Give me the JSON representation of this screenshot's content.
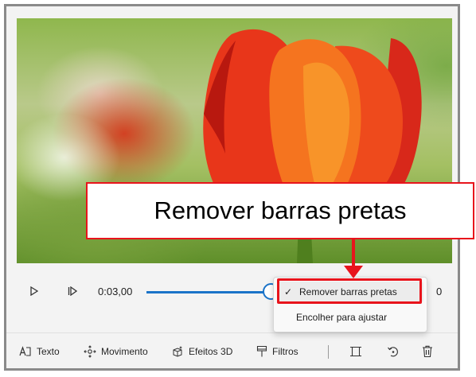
{
  "player": {
    "current_time": "0:03,00",
    "end_time_partial": "0",
    "progress_fraction": 0.46
  },
  "menu": {
    "items": [
      {
        "label": "Remover barras pretas",
        "checked": true
      },
      {
        "label": "Encolher para ajustar",
        "checked": false
      }
    ]
  },
  "toolbar": {
    "items": [
      {
        "label": "Texto",
        "icon": "text-icon"
      },
      {
        "label": "Movimento",
        "icon": "motion-icon"
      },
      {
        "label": "Efeitos 3D",
        "icon": "effects-3d-icon"
      },
      {
        "label": "Filtros",
        "icon": "filters-icon"
      }
    ],
    "extra_icons": [
      "resize-icon",
      "rotate-icon",
      "delete-icon"
    ]
  },
  "annotation": {
    "callout_text": "Remover barras pretas",
    "highlight_color": "#e8141c"
  },
  "colors": {
    "accent": "#1a73c8",
    "tulip": "#f0401e"
  }
}
